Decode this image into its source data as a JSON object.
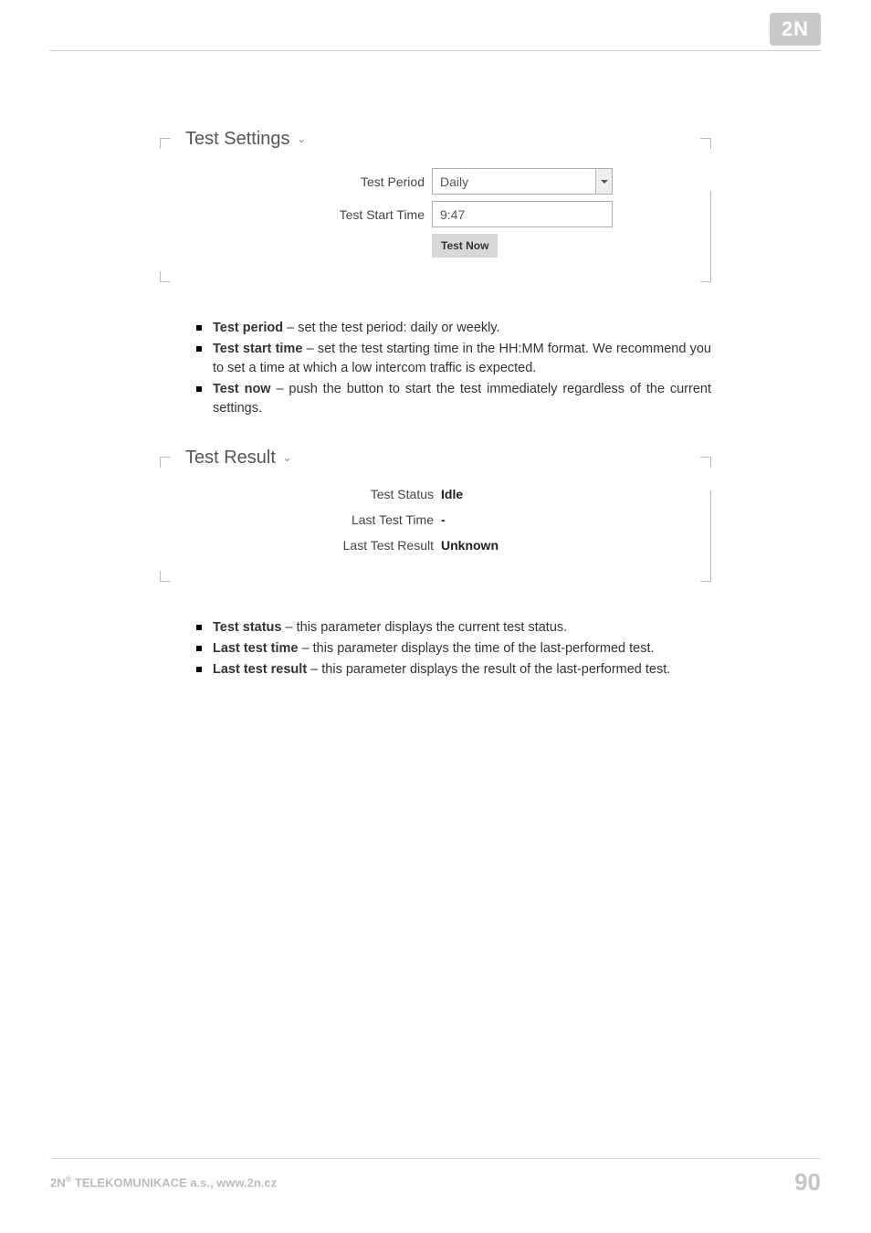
{
  "header": {
    "logo": "2N"
  },
  "settings": {
    "legend": "Test Settings",
    "period_label": "Test Period",
    "period_value": "Daily",
    "start_label": "Test Start Time",
    "start_value": "9:47",
    "button_label": "Test Now"
  },
  "settings_desc": {
    "l1_b": "Test period",
    "l1_t": " – set the test period: daily or weekly.",
    "l2_b": "Test start time",
    "l2_t": " – set the test starting time in the HH:MM format. We recommend you to set a time at which a low intercom traffic is expected.",
    "l3_b": "Test now",
    "l3_t": " – push the button to start the test immediately regardless of the current settings."
  },
  "result": {
    "legend": "Test Result",
    "status_label": "Test Status",
    "status_value": "Idle",
    "last_time_label": "Last Test Time",
    "last_time_value": "-",
    "last_result_label": "Last Test Result",
    "last_result_value": "Unknown"
  },
  "result_desc": {
    "l1_b": "Test status",
    "l1_t": " – this parameter displays the current test status.",
    "l2_b": "Last test time",
    "l2_t": " – this parameter displays the time of the last-performed test.",
    "l3_b": "Last test result",
    "l3_t": " – this parameter displays the result of the last-performed test."
  },
  "footer": {
    "company_prefix": "2N",
    "company_sup": "®",
    "company_suffix": " TELEKOMUNIKACE a.s., www.2n.cz",
    "page": "90"
  }
}
